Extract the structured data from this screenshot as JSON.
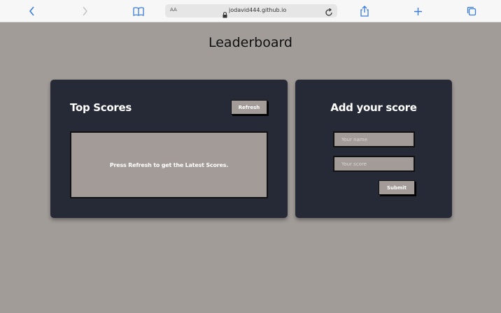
{
  "browser": {
    "address_aa": "AA",
    "url": "jodavid444.github.io"
  },
  "page": {
    "title": "Leaderboard"
  },
  "scores_card": {
    "title": "Top Scores",
    "refresh_label": "Refresh",
    "empty_message": "Press Refresh to get the Latest Scores."
  },
  "add_card": {
    "title": "Add your score",
    "name_placeholder": "Your name",
    "score_placeholder": "Your score",
    "submit_label": "Submit"
  },
  "colors": {
    "page_background": "#a29c99",
    "card_background": "#252a36",
    "accent_blue": "#3a7be0"
  }
}
